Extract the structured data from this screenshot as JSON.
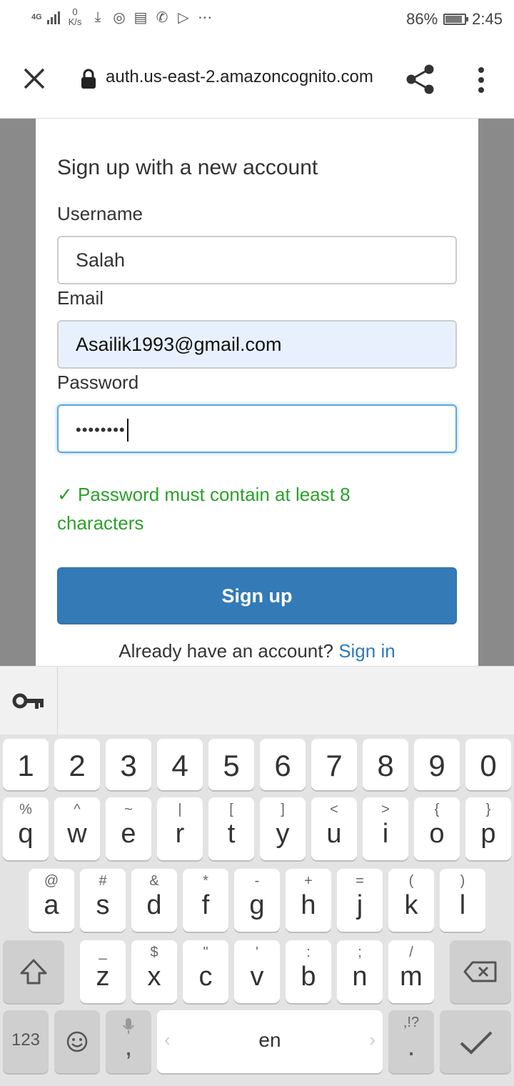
{
  "status_bar": {
    "network": "4G",
    "speed_value": "0",
    "speed_unit": "K/s",
    "battery_percent": "86%",
    "battery_level": 0.86,
    "time": "2:45",
    "notification_icons": [
      "download-icon",
      "hotspot-icon",
      "cast-icon",
      "whatsapp-icon",
      "play-store-icon",
      "more-icon"
    ]
  },
  "browser": {
    "url": "auth.us-east-2.amazoncognito.com"
  },
  "form": {
    "title": "Sign up with a new account",
    "username_label": "Username",
    "username_value": "Salah",
    "email_label": "Email",
    "email_value": "Asailik1993@gmail.com",
    "password_label": "Password",
    "password_value": "••••••••",
    "validation_check": "✓",
    "validation_message": "Password must contain at least 8 characters",
    "signup_button": "Sign up",
    "signin_prompt": "Already have an account?",
    "signin_link": "Sign in"
  },
  "keyboard": {
    "number_row": [
      "1",
      "2",
      "3",
      "4",
      "5",
      "6",
      "7",
      "8",
      "9",
      "0"
    ],
    "row1": [
      {
        "main": "q",
        "sub": "%"
      },
      {
        "main": "w",
        "sub": "^"
      },
      {
        "main": "e",
        "sub": "~"
      },
      {
        "main": "r",
        "sub": "|"
      },
      {
        "main": "t",
        "sub": "["
      },
      {
        "main": "y",
        "sub": "]"
      },
      {
        "main": "u",
        "sub": "<"
      },
      {
        "main": "i",
        "sub": ">"
      },
      {
        "main": "o",
        "sub": "{"
      },
      {
        "main": "p",
        "sub": "}"
      }
    ],
    "row2": [
      {
        "main": "a",
        "sub": "@"
      },
      {
        "main": "s",
        "sub": "#"
      },
      {
        "main": "d",
        "sub": "&"
      },
      {
        "main": "f",
        "sub": "*"
      },
      {
        "main": "g",
        "sub": "-"
      },
      {
        "main": "h",
        "sub": "+"
      },
      {
        "main": "j",
        "sub": "="
      },
      {
        "main": "k",
        "sub": "("
      },
      {
        "main": "l",
        "sub": ")"
      }
    ],
    "row3": [
      {
        "main": "z",
        "sub": "_"
      },
      {
        "main": "x",
        "sub": "$"
      },
      {
        "main": "c",
        "sub": "\""
      },
      {
        "main": "v",
        "sub": "'"
      },
      {
        "main": "b",
        "sub": ":"
      },
      {
        "main": "n",
        "sub": ";"
      },
      {
        "main": "m",
        "sub": "/"
      }
    ],
    "key_123": "123",
    "comma": ",",
    "space_label": "en",
    "period": ".",
    "period_sub": ",!?"
  },
  "colors": {
    "primary_button": "#337ab7",
    "link": "#2e7ab8",
    "success": "#2aa12a",
    "autofill_bg": "#e8f0fe"
  }
}
